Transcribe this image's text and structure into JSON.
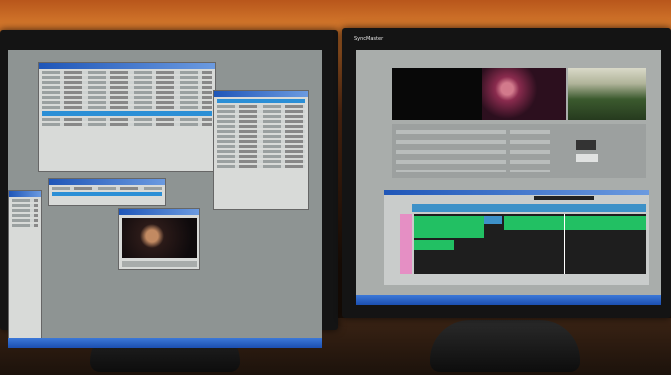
{
  "scene": {
    "description_label": "",
    "left_monitor": {
      "brand": ""
    },
    "right_monitor": {
      "brand": "SyncMaster"
    }
  },
  "colors": {
    "wall": "#c8702c",
    "screen_gray": "#8e9493",
    "selection_blue": "#2b8fd6",
    "timeline_green": "#22c063",
    "timeline_blue": "#3d91c8",
    "track_label_pink": "#e58fc4"
  },
  "icons": {
    "left_window_close": "close-icon",
    "right_window_close": "close-icon"
  }
}
